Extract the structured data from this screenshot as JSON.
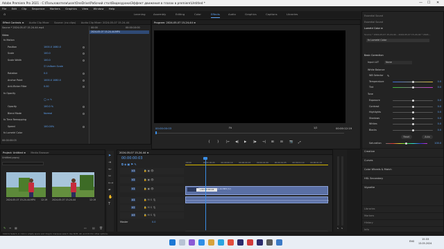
{
  "window": {
    "title": "Adobe Premiere Pro 2021 - C:\\Пользователи\\user\\OneDrive\\Рабочий стол\\Видеоуроки\\Эффект движения в глазах в premiere\\Untitled *",
    "controls": [
      "—",
      "☐",
      "✕"
    ]
  },
  "menu": [
    "File",
    "Edit",
    "Clip",
    "Sequence",
    "Markers",
    "Graphics",
    "View",
    "Window",
    "Help"
  ],
  "workspaces": [
    "Learning",
    "Assembly",
    "Editing",
    "Color",
    "Effects",
    "Audio",
    "Graphics",
    "Captions",
    "Libraries"
  ],
  "workspace_active": "Effects",
  "source_tabs": [
    "Effect Controls ≡",
    "Audio Clip Mixer",
    "Source: (no clips)",
    "Audio Clip Mixer: 2024-05-07 15-24-44"
  ],
  "effect_controls": {
    "source_line": "Source * 2024-05-07 15-24-44.mp4",
    "seq_line": "2024-05-07 15-24-44 * 2024...",
    "time_left": "00:00",
    "time_right": "00:00:10:00",
    "clip_label": "2024-05-07 15-24-44.MP4",
    "video_header": "Video",
    "rows": [
      {
        "name": "fx Motion",
        "val": ""
      },
      {
        "name": "Position",
        "val": "1000.0   1080.0"
      },
      {
        "name": "Scale",
        "val": "100.0"
      },
      {
        "name": "Scale Width",
        "val": "100.0"
      },
      {
        "name": "",
        "val": "☑ Uniform Scale"
      },
      {
        "name": "Rotation",
        "val": "0.0"
      },
      {
        "name": "Anchor Point",
        "val": "1000.0   1080.0"
      },
      {
        "name": "Anti-flicker Filter",
        "val": "0.00"
      },
      {
        "name": "fx Opacity",
        "val": ""
      },
      {
        "name": "",
        "val": "◯ ▭ ✎"
      },
      {
        "name": "Opacity",
        "val": "100.0 %"
      },
      {
        "name": "Blend Mode",
        "val": "Normal"
      },
      {
        "name": "fx Time Remapping",
        "val": ""
      },
      {
        "name": "Speed",
        "val": "100.00%"
      },
      {
        "name": "fx Lumetri Color",
        "val": ""
      }
    ]
  },
  "program": {
    "tab": "Program: 2024-05-07 15-24-44 ≡",
    "timecode": "00:00:00:03",
    "fit": "Fit",
    "quality": "1/2",
    "duration": "00:00:12:19",
    "transport": [
      "{",
      "}",
      "|←",
      "◀|",
      "▶",
      "|▶",
      "→|",
      "⊞",
      "⊟",
      "📷",
      "⤢"
    ]
  },
  "project": {
    "tabs": [
      "Project: Untitled ≡",
      "Media Browser"
    ],
    "name": "Untitled.prproj",
    "items": [
      {
        "name": "2024-05-07 15-24-44.MP4",
        "dur": "12:19"
      },
      {
        "name": "2024-05-07 15-24-44",
        "dur": "12:19"
      }
    ]
  },
  "timeline": {
    "tab": "2024-05-07 15-24-44 ≡",
    "timecode": "00:00:00:03",
    "ruler": [
      ":00:00",
      "00:00:00:05",
      "00:00:00:10",
      "00:00:00:15",
      "00:00:01:00",
      "00:00:01:05",
      "00:00:01:10",
      "00:00:01:15"
    ],
    "tracks_video": [
      "V3",
      "V2",
      "V1"
    ],
    "tracks_audio": [
      "A1",
      "A2",
      "A3"
    ],
    "master": "Master",
    "master_val": "0.0",
    "clip_tooltip": "+00:00:00:03",
    "clip_name": "2024-05-07 15-24-44.MP4 [V]",
    "audio_db": [
      "0.0",
      "0.0"
    ],
    "meter_labels": [
      "S",
      "S"
    ]
  },
  "lumetri": {
    "top_labels": [
      "Essential Sound",
      "Essential Sound"
    ],
    "title": "Lumetri Color ≡",
    "src_line": "Source * 2024-05-07 15-24-44...   2024-05-07 15-24-44 * 2024...",
    "fx_line": "fx   Lumetri Color",
    "basic": "Basic Correction",
    "input_lut_label": "Input LUT",
    "input_lut_val": "None",
    "white_balance": "White Balance",
    "wb_selector": "WB Selector",
    "sliders1": [
      {
        "name": "Temperature",
        "val": "0.0",
        "pos": 0.5
      },
      {
        "name": "Tint",
        "val": "0.0",
        "pos": 0.5
      }
    ],
    "tone": "Tone",
    "sliders2": [
      {
        "name": "Exposure",
        "val": "0.0",
        "pos": 0.5
      },
      {
        "name": "Contrast",
        "val": "0.0",
        "pos": 0.5
      },
      {
        "name": "Highlights",
        "val": "0.0",
        "pos": 0.5
      },
      {
        "name": "Shadows",
        "val": "0.0",
        "pos": 0.5
      },
      {
        "name": "Whites",
        "val": "0.0",
        "pos": 0.5
      },
      {
        "name": "Blacks",
        "val": "0.0",
        "pos": 0.5
      }
    ],
    "reset": "Reset",
    "auto": "Auto",
    "saturation": {
      "name": "Saturation",
      "val": "100.0"
    },
    "sections": [
      "Creative",
      "Curves",
      "Color Wheels & Match",
      "HSL Secondary",
      "Vignette"
    ],
    "bottom_panels": [
      "Libraries",
      "Markers",
      "History",
      "Info"
    ]
  },
  "taskbar": {
    "lang": "ENG",
    "time": "15:33",
    "date": "13.05.2024",
    "status": "Click to Select, or click in empty space and drag to marquee select. Use Shift, Alt, and Ctrl for other options."
  },
  "colors": {
    "accent": "#5ea4f7",
    "clip": "#5a6fa4",
    "playhead": "#3a8ee6"
  }
}
